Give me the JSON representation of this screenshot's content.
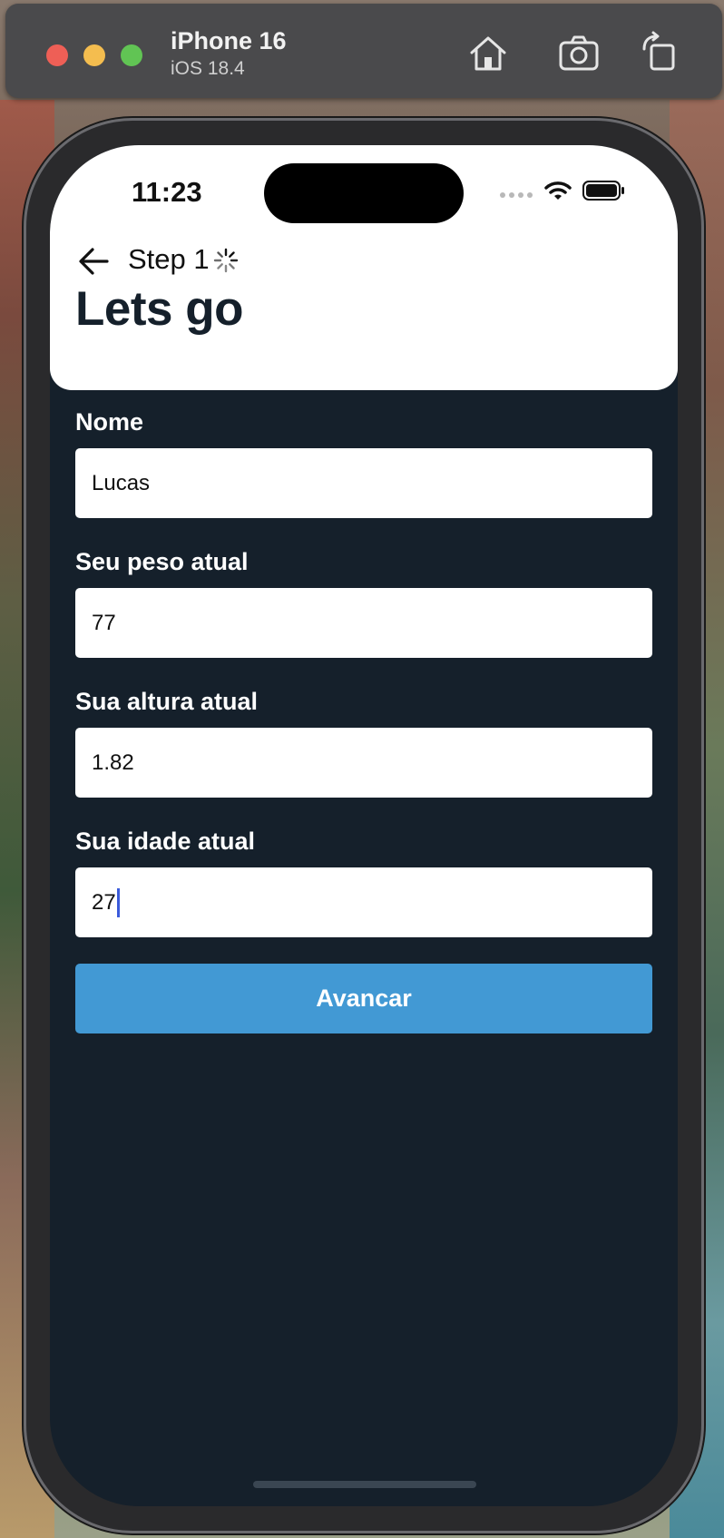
{
  "simulator": {
    "device_name": "iPhone 16",
    "os_version": "iOS 18.4",
    "toolbar": {
      "home_icon": "home-icon",
      "screenshot_icon": "camera-icon",
      "rotate_icon": "rotate-icon"
    }
  },
  "status_bar": {
    "time": "11:23"
  },
  "header": {
    "step_label": "Step 1",
    "title": "Lets go"
  },
  "form": {
    "fields": [
      {
        "label": "Nome",
        "value": "Lucas"
      },
      {
        "label": "Seu peso atual",
        "value": "77"
      },
      {
        "label": "Sua altura atual",
        "value": "1.82"
      },
      {
        "label": "Sua idade atual",
        "value": "27"
      }
    ],
    "submit_label": "Avancar"
  },
  "colors": {
    "background": "#15202b",
    "header_bg": "#ffffff",
    "button": "#4299d4",
    "caret": "#3b5bdb"
  }
}
